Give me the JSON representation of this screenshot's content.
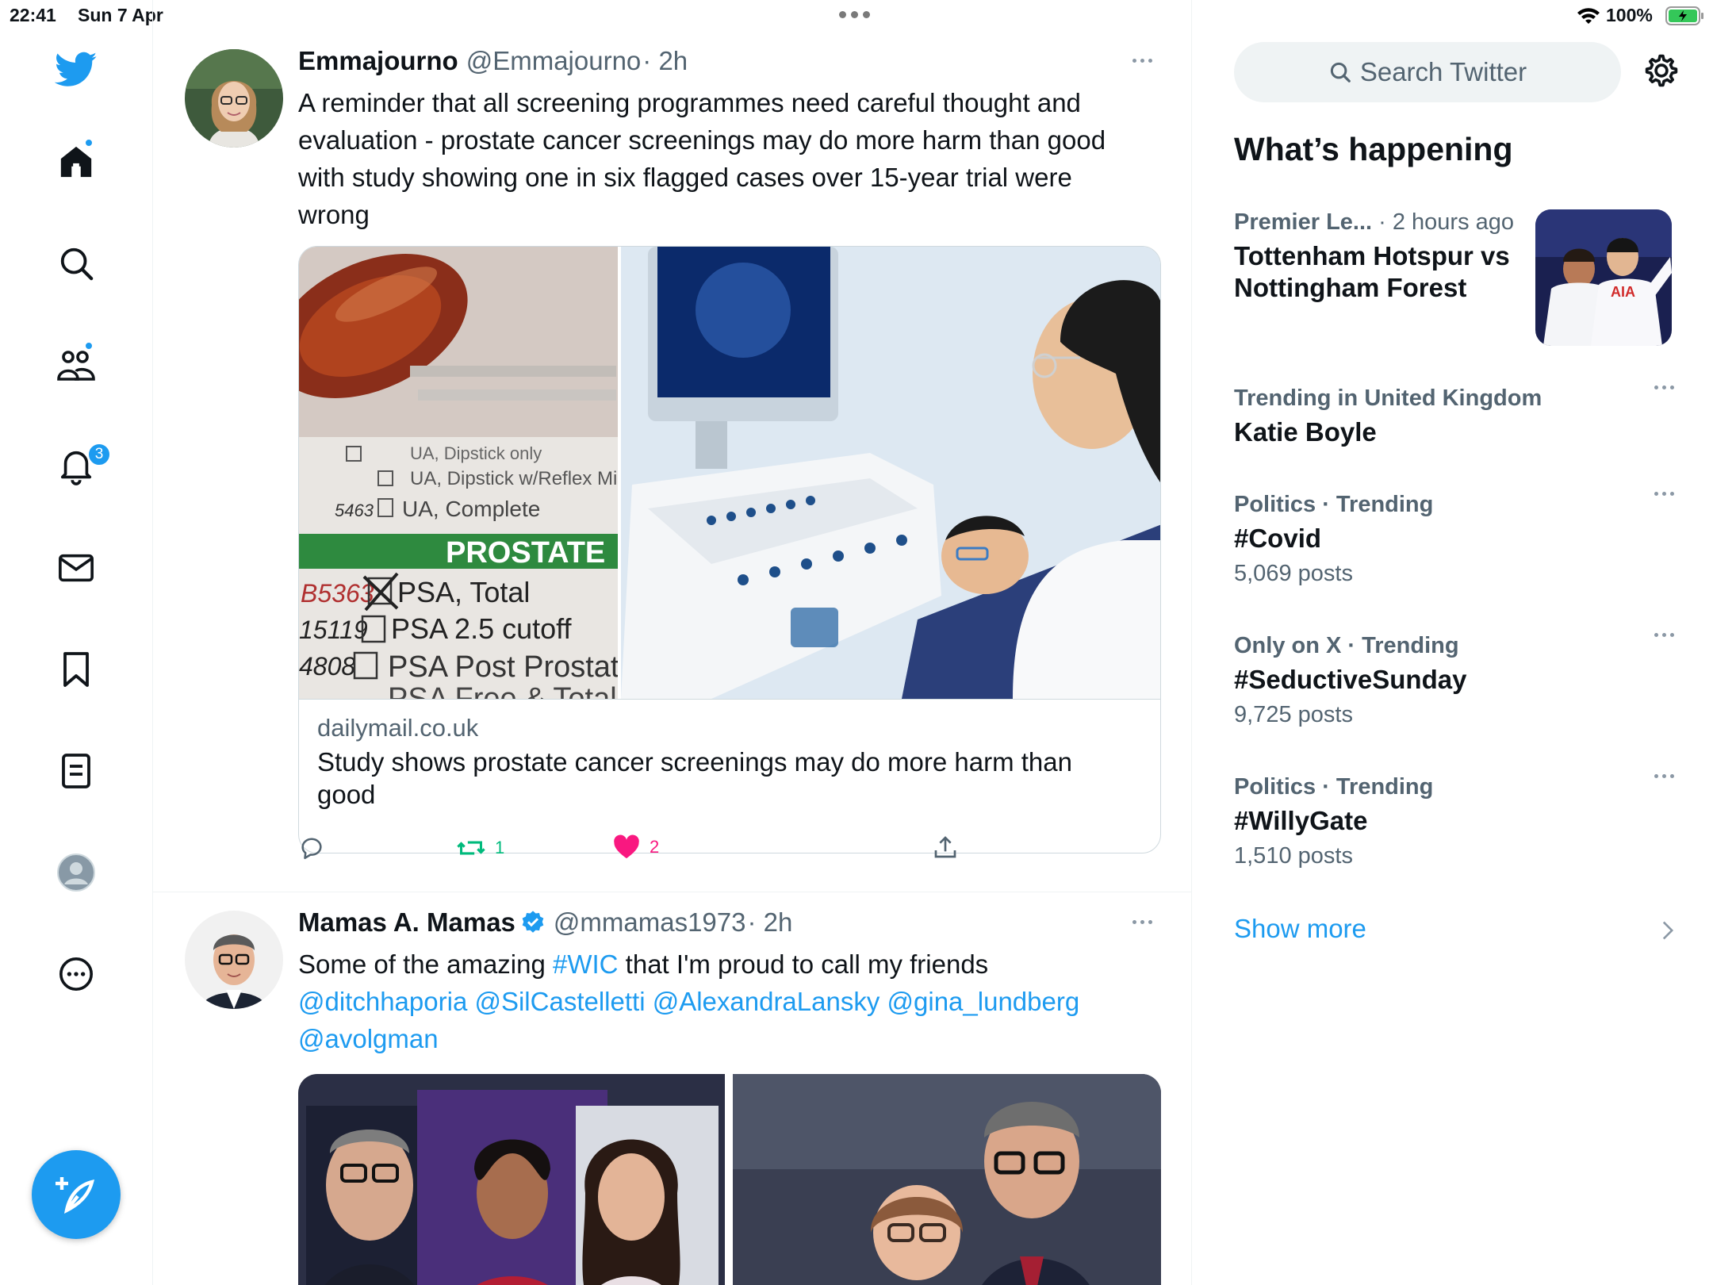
{
  "status_bar": {
    "time": "22:41",
    "date": "Sun 7 Apr",
    "battery": "100%"
  },
  "nav": {
    "items": [
      "home",
      "explore",
      "communities",
      "notifications",
      "messages",
      "bookmarks",
      "lists",
      "profile",
      "more"
    ],
    "notifications_badge": "3"
  },
  "tweets": [
    {
      "name": "Emmajourno",
      "handle": "@Emmajourno",
      "time": "· 2h",
      "body": "A reminder that all screening programmes need careful thought and evaluation - prostate cancer screenings may do more harm than good with study showing one in six flagged cases over 15-year trial were wrong",
      "card": {
        "image_text": {
          "line1": "UA, Dipstick only",
          "line2": "UA, Dipstick w/Reflex Micro",
          "code3": "5463",
          "line3": "UA, Complete",
          "banner": "PROSTATE",
          "code4": "B5363",
          "line4": "PSA, Total",
          "code5": "15119",
          "line5": "PSA 2.5 cutoff",
          "code6": "4808",
          "line6": "PSA Post Prostatecto",
          "line7": "PSA Free & Total"
        },
        "domain": "dailymail.co.uk",
        "title": "Study shows prostate cancer screenings may do more harm than good"
      },
      "retweets": "1",
      "likes": "2"
    },
    {
      "name": "Mamas A. Mamas",
      "handle": "@mmamas1973",
      "time": "· 2h",
      "body_prefix": "Some of the amazing ",
      "hashtag": "#WIC",
      "body_suffix": " that I'm proud to call my friends",
      "mentions": "@ditchhaporia @SilCastelletti @AlexandraLansky @gina_lundberg @avolgman"
    }
  ],
  "right": {
    "search_placeholder": "Search Twitter",
    "whats_happening": "What’s happening",
    "trends": [
      {
        "meta_bold": "Premier Le...",
        "meta": " · 2 hours ago",
        "title": "Tottenham Hotspur vs Nottingham Forest",
        "image_text": "AIA"
      },
      {
        "meta": "Trending in United Kingdom",
        "title": "Katie Boyle"
      },
      {
        "meta": "Politics · Trending",
        "title": "#Covid",
        "count": "5,069 posts"
      },
      {
        "meta": "Only on X · Trending",
        "title": "#SeductiveSunday",
        "count": "9,725 posts"
      },
      {
        "meta": "Politics · Trending",
        "title": "#WillyGate",
        "count": "1,510 posts"
      }
    ],
    "show_more": "Show more"
  },
  "colors": {
    "accent": "#1d9bf0",
    "like": "#f91880",
    "retweet": "#00ba7c",
    "secondary_text": "#536471"
  }
}
